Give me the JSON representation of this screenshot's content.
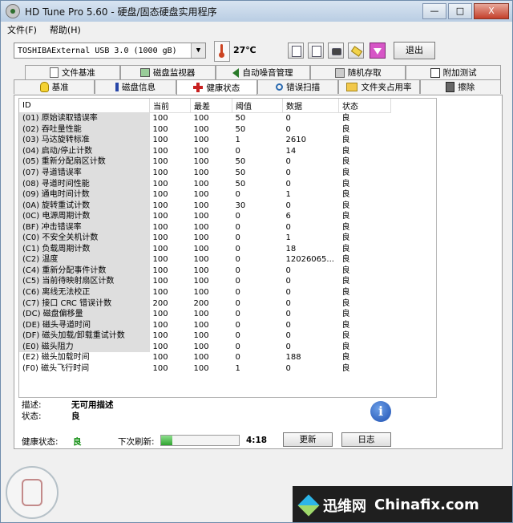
{
  "window": {
    "title": "HD Tune Pro 5.60 - 硬盘/固态硬盘实用程序",
    "controls": [
      "—",
      "□",
      "X"
    ]
  },
  "menu": [
    {
      "label": "文件(F)"
    },
    {
      "label": "帮助(H)"
    }
  ],
  "toolbar": {
    "drive": "TOSHIBAExternal USB 3.0 (1000 gB)",
    "drive_arrow": "▼",
    "temperature": "27℃",
    "exit_label": "退出"
  },
  "tabs_row1": [
    {
      "label": "文件基准",
      "icon": "document-icon"
    },
    {
      "label": "磁盘监视器",
      "icon": "monitor-icon"
    },
    {
      "label": "自动噪音管理",
      "icon": "speaker-icon"
    },
    {
      "label": "随机存取",
      "icon": "random-icon"
    },
    {
      "label": "附加测试",
      "icon": "extra-icon"
    }
  ],
  "tabs_row2": [
    {
      "label": "基准",
      "icon": "bulb-icon"
    },
    {
      "label": "磁盘信息",
      "icon": "info-icon"
    },
    {
      "label": "健康状态",
      "icon": "red-cross-icon",
      "active": true
    },
    {
      "label": "错误扫描",
      "icon": "magnifier-icon"
    },
    {
      "label": "文件夹占用率",
      "icon": "folder-icon"
    },
    {
      "label": "擦除",
      "icon": "trash-icon"
    }
  ],
  "table": {
    "headers": [
      "ID",
      "当前",
      "最差",
      "阈值",
      "数据",
      "状态"
    ],
    "rows": [
      [
        "(01) 原始读取错误率",
        "100",
        "100",
        "50",
        "0",
        "良"
      ],
      [
        "(02) 吞吐量性能",
        "100",
        "100",
        "50",
        "0",
        "良"
      ],
      [
        "(03) 马达旋转标准",
        "100",
        "100",
        "1",
        "2610",
        "良"
      ],
      [
        "(04) 启动/停止计数",
        "100",
        "100",
        "0",
        "14",
        "良"
      ],
      [
        "(05) 重新分配扇区计数",
        "100",
        "100",
        "50",
        "0",
        "良"
      ],
      [
        "(07) 寻道错误率",
        "100",
        "100",
        "50",
        "0",
        "良"
      ],
      [
        "(08) 寻道时间性能",
        "100",
        "100",
        "50",
        "0",
        "良"
      ],
      [
        "(09) 通电时间计数",
        "100",
        "100",
        "0",
        "1",
        "良"
      ],
      [
        "(0A) 旋转重试计数",
        "100",
        "100",
        "30",
        "0",
        "良"
      ],
      [
        "(0C) 电源周期计数",
        "100",
        "100",
        "0",
        "6",
        "良"
      ],
      [
        "(BF) 冲击错误率",
        "100",
        "100",
        "0",
        "0",
        "良"
      ],
      [
        "(C0) 不安全关机计数",
        "100",
        "100",
        "0",
        "1",
        "良"
      ],
      [
        "(C1) 负载周期计数",
        "100",
        "100",
        "0",
        "18",
        "良"
      ],
      [
        "(C2) 温度",
        "100",
        "100",
        "0",
        "12026065...",
        "良"
      ],
      [
        "(C4) 重新分配事件计数",
        "100",
        "100",
        "0",
        "0",
        "良"
      ],
      [
        "(C5) 当前待映射扇区计数",
        "100",
        "100",
        "0",
        "0",
        "良"
      ],
      [
        "(C6) 离线无法校正",
        "100",
        "100",
        "0",
        "0",
        "良"
      ],
      [
        "(C7) 接口 CRC 错误计数",
        "200",
        "200",
        "0",
        "0",
        "良"
      ],
      [
        "(DC) 磁盘偏移量",
        "100",
        "100",
        "0",
        "0",
        "良"
      ],
      [
        "(DE) 磁头寻道时间",
        "100",
        "100",
        "0",
        "0",
        "良"
      ],
      [
        "(DF) 磁头加载/卸载重试计数",
        "100",
        "100",
        "0",
        "0",
        "良"
      ],
      [
        "(E0) 磁头阻力",
        "100",
        "100",
        "0",
        "0",
        "良"
      ],
      [
        "(E2) 磁头加载时间",
        "100",
        "100",
        "0",
        "188",
        "良"
      ],
      [
        "(F0) 磁头飞行时间",
        "100",
        "100",
        "1",
        "0",
        "良"
      ]
    ]
  },
  "details": {
    "desc_label": "描述:",
    "desc_value": "无可用描述",
    "status_label": "状态:",
    "status_value": "良"
  },
  "status": {
    "health_label": "健康状态:",
    "health_value": "良",
    "next_label": "下次刷新:",
    "progress": 0.14,
    "timer": "4:18",
    "refresh_label": "更新",
    "log_label": "日志"
  },
  "watermark": {
    "cn": "迅维网",
    "en": "Chinafix.com"
  },
  "colors": {
    "health_good": "#0a8a0a",
    "progress": "#2fa32f",
    "exit_btn_accent": "#d655c6"
  }
}
